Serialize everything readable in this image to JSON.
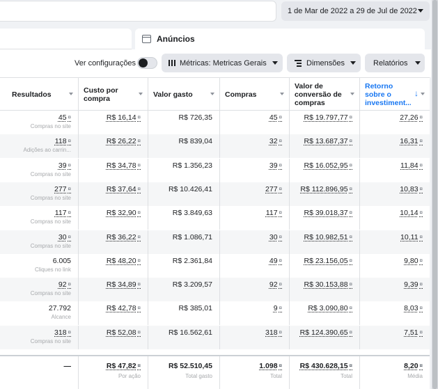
{
  "date_range": "1 de Mar de 2022 a 29 de Jul de 2022",
  "panel_title": "Anúncios",
  "toolbar": {
    "ver_label": "Ver configurações",
    "metrics_label": "Métricas: Metricas Gerais",
    "dimensions_label": "Dimensões",
    "reports_label": "Relatórios"
  },
  "columns": [
    "Resultados",
    "Custo por compra",
    "Valor gasto",
    "Compras",
    "Valor de conversão de compras",
    "Retorno sobre o investiment..."
  ],
  "rows": [
    {
      "results": "45",
      "results_type": "Compras no site",
      "cost": "R$ 16,14",
      "spent": "R$ 726,35",
      "purchases": "45",
      "conv_value": "R$ 19.797,77",
      "roas": "27,26"
    },
    {
      "results": "118",
      "results_type": "Adições ao carrin...",
      "cost": "R$ 26,22",
      "spent": "R$ 839,04",
      "purchases": "32",
      "conv_value": "R$ 13.687,37",
      "roas": "16,31"
    },
    {
      "results": "39",
      "results_type": "Compras no site",
      "cost": "R$ 34,78",
      "spent": "R$ 1.356,23",
      "purchases": "39",
      "conv_value": "R$ 16.052,95",
      "roas": "11,84"
    },
    {
      "results": "277",
      "results_type": "Compras no site",
      "cost": "R$ 37,64",
      "spent": "R$ 10.426,41",
      "purchases": "277",
      "conv_value": "R$ 112.896,95",
      "roas": "10,83"
    },
    {
      "results": "117",
      "results_type": "Compras no site",
      "cost": "R$ 32,90",
      "spent": "R$ 3.849,63",
      "purchases": "117",
      "conv_value": "R$ 39.018,37",
      "roas": "10,14"
    },
    {
      "results": "30",
      "results_type": "Compras no site",
      "cost": "R$ 36,22",
      "spent": "R$ 1.086,71",
      "purchases": "30",
      "conv_value": "R$ 10.982,51",
      "roas": "10,11"
    },
    {
      "results": "6.005",
      "results_type": "Cliques no link",
      "cost": "R$ 48,20",
      "spent": "R$ 2.361,84",
      "purchases": "49",
      "conv_value": "R$ 23.156,05",
      "roas": "9,80"
    },
    {
      "results": "92",
      "results_type": "Compras no site",
      "cost": "R$ 34,89",
      "spent": "R$ 3.209,57",
      "purchases": "92",
      "conv_value": "R$ 30.153,88",
      "roas": "9,39"
    },
    {
      "results": "27.792",
      "results_type": "Alcance",
      "cost": "R$ 42,78",
      "spent": "R$ 385,01",
      "purchases": "9",
      "conv_value": "R$ 3.090,80",
      "roas": "8,03"
    },
    {
      "results": "318",
      "results_type": "Compras no site",
      "cost": "R$ 52,08",
      "spent": "R$ 16.562,61",
      "purchases": "318",
      "conv_value": "R$ 124.390,65",
      "roas": "7,51"
    }
  ],
  "totals": {
    "results": "—",
    "cost": "R$ 47,82",
    "cost_sub": "Por ação",
    "spent": "R$ 52.510,45",
    "spent_sub": "Total gasto",
    "purchases": "1.098",
    "purchases_sub": "Total",
    "conv_value": "R$ 430.628,15",
    "conv_value_sub": "Total",
    "roas": "8,20",
    "roas_sub": "Média"
  }
}
